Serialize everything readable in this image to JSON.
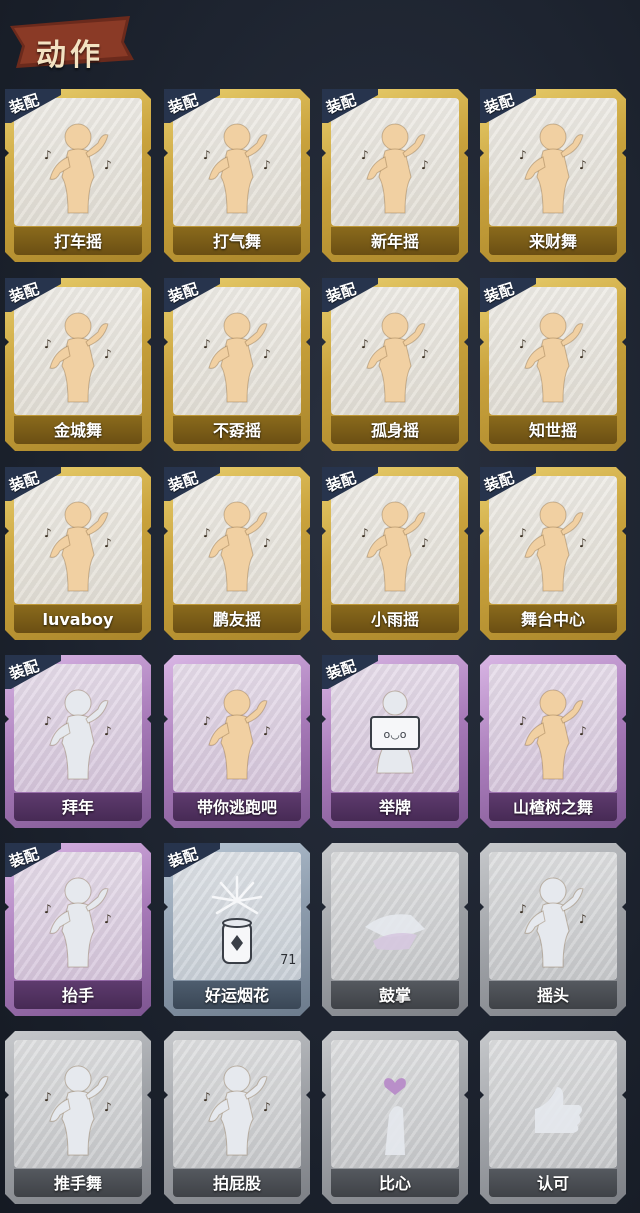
{
  "header": {
    "title": "动作"
  },
  "badge_label": "装配",
  "cards": [
    {
      "name": "打车摇",
      "tier": "gold",
      "equipped": true,
      "icon": "dance-pose-icon"
    },
    {
      "name": "打气舞",
      "tier": "gold",
      "equipped": true,
      "icon": "dance-pose-icon"
    },
    {
      "name": "新年摇",
      "tier": "gold",
      "equipped": true,
      "icon": "dance-pose-icon"
    },
    {
      "name": "来财舞",
      "tier": "gold",
      "equipped": true,
      "icon": "dance-pose-icon"
    },
    {
      "name": "金城舞",
      "tier": "gold",
      "equipped": true,
      "icon": "dance-pose-icon"
    },
    {
      "name": "不孬摇",
      "tier": "gold",
      "equipped": true,
      "icon": "dance-pose-icon"
    },
    {
      "name": "孤身摇",
      "tier": "gold",
      "equipped": true,
      "icon": "dance-pose-icon"
    },
    {
      "name": "知世摇",
      "tier": "gold",
      "equipped": true,
      "icon": "dance-pose-icon"
    },
    {
      "name": "luvaboy",
      "tier": "gold",
      "equipped": true,
      "icon": "dance-pose-icon"
    },
    {
      "name": "鹏友摇",
      "tier": "gold",
      "equipped": true,
      "icon": "dance-pose-icon"
    },
    {
      "name": "小雨摇",
      "tier": "gold",
      "equipped": true,
      "icon": "dance-pose-icon"
    },
    {
      "name": "舞台中心",
      "tier": "gold",
      "equipped": true,
      "icon": "dance-pose-icon"
    },
    {
      "name": "拜年",
      "tier": "purple",
      "equipped": true,
      "icon": "bow-pose-icon"
    },
    {
      "name": "带你逃跑吧",
      "tier": "purple",
      "equipped": false,
      "icon": "dance-pose-icon"
    },
    {
      "name": "举牌",
      "tier": "purple",
      "equipped": true,
      "icon": "sign-hold-icon"
    },
    {
      "name": "山楂树之舞",
      "tier": "purple",
      "equipped": false,
      "icon": "dance-pose-icon"
    },
    {
      "name": "抬手",
      "tier": "purple",
      "equipped": true,
      "icon": "raise-hand-icon"
    },
    {
      "name": "好运烟花",
      "tier": "blue",
      "equipped": true,
      "icon": "firework-icon",
      "count": "71"
    },
    {
      "name": "鼓掌",
      "tier": "gray",
      "equipped": false,
      "icon": "clap-icon"
    },
    {
      "name": "摇头",
      "tier": "gray",
      "equipped": false,
      "icon": "shake-head-icon"
    },
    {
      "name": "推手舞",
      "tier": "gray",
      "equipped": false,
      "icon": "push-hands-icon"
    },
    {
      "name": "拍屁股",
      "tier": "gray",
      "equipped": false,
      "icon": "pat-icon"
    },
    {
      "name": "比心",
      "tier": "gray",
      "equipped": false,
      "icon": "finger-heart-icon"
    },
    {
      "name": "认可",
      "tier": "gray",
      "equipped": false,
      "icon": "thumbs-up-icon"
    }
  ],
  "colors": {
    "gold": "#c9a23c",
    "purple": "#a87bb9",
    "blue": "#8d9cad",
    "gray": "#9ea1a6",
    "badge": "#27344d",
    "figure_gold": "#f1d0a2",
    "figure_silver": "#e6e9ee"
  }
}
